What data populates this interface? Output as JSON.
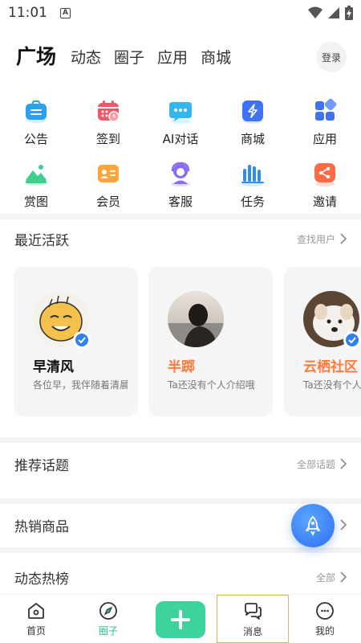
{
  "status": {
    "time": "11:01",
    "badge": "A"
  },
  "tabs": [
    {
      "label": "广场"
    },
    {
      "label": "动态"
    },
    {
      "label": "圈子"
    },
    {
      "label": "应用"
    },
    {
      "label": "商城"
    }
  ],
  "login_label": "登录",
  "grid": [
    {
      "label": "公告",
      "icon": "announcement-icon"
    },
    {
      "label": "签到",
      "icon": "checkin-calendar-icon"
    },
    {
      "label": "AI对话",
      "icon": "ai-chat-icon"
    },
    {
      "label": "商城",
      "icon": "shop-bolt-icon"
    },
    {
      "label": "应用",
      "icon": "apps-icon"
    },
    {
      "label": "赏图",
      "icon": "picture-icon"
    },
    {
      "label": "会员",
      "icon": "member-card-icon"
    },
    {
      "label": "客服",
      "icon": "customer-service-icon"
    },
    {
      "label": "任务",
      "icon": "task-bars-icon"
    },
    {
      "label": "邀请",
      "icon": "invite-share-icon"
    }
  ],
  "recent": {
    "title": "最近活跃",
    "link": "查找用户",
    "users": [
      {
        "name": "早清风",
        "bio": "各位早，我伴随着清晨",
        "verified": true
      },
      {
        "name": "半踯",
        "bio": "Ta还没有个人介绍哦",
        "verified": false
      },
      {
        "name": "云栖社区",
        "bio": "Ta还没有个人介绍哦",
        "verified": true
      }
    ]
  },
  "topics": {
    "title": "推荐话题",
    "link": "全部话题"
  },
  "hot_goods": {
    "title": "热销商品"
  },
  "hot_posts": {
    "title": "动态热榜",
    "link": "全部"
  },
  "nav": [
    {
      "label": "首页"
    },
    {
      "label": "圈子"
    },
    {
      "label": ""
    },
    {
      "label": "消息"
    },
    {
      "label": "我的"
    }
  ],
  "colors": {
    "accent": "#3ed39a",
    "brand_blue": "#2f6ff0",
    "orange_name": "#ff7a3d"
  }
}
